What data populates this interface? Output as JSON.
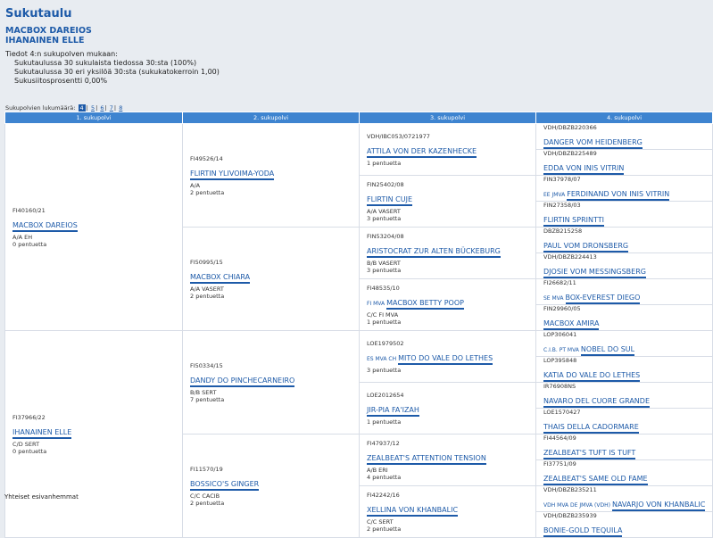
{
  "page": {
    "title": "Sukutaulu",
    "sire": "MACBOX DAREIOS",
    "dam": "IHANAINEN ELLE"
  },
  "stats": {
    "line1": "Tiedot 4:n sukupolven mukaan:",
    "line2": "Sukutaulussa 30 sukulaista tiedossa 30:sta (100%)",
    "line3": "Sukutaulussa 30 eri yksilöä 30:sta (sukukatokerroin 1,00)",
    "line4": "Sukusiitosprosentti 0,00%"
  },
  "generations": {
    "label": "Sukupolvien lukumäärä:",
    "options": [
      "4",
      "5",
      "6",
      "7",
      "8"
    ],
    "sep": "|"
  },
  "headers": [
    "1. sukupolvi",
    "2. sukupolvi",
    "3. sukupolvi",
    "4. sukupolvi"
  ],
  "g1": [
    {
      "reg": "FI40160/21",
      "name": "MACBOX DAREIOS",
      "info1": "A/A  EH",
      "info2": "0 pentuetta"
    },
    {
      "reg": "FI37966/22",
      "name": "IHANAINEN ELLE",
      "info1": "C/D  SERT",
      "info2": "0 pentuetta"
    }
  ],
  "g2": [
    {
      "reg": "FI49526/14",
      "name": "FLIRTIN YLIVOIMA-YODA",
      "info1": "A/A",
      "info2": "2 pentuetta"
    },
    {
      "reg": "FI50995/15",
      "name": "MACBOX CHIARA",
      "info1": "A/A  VASERT",
      "info2": "2 pentuetta"
    },
    {
      "reg": "FI50334/15",
      "name": "DANDY DO PINCHECARNEIRO",
      "info1": "B/B  SERT",
      "info2": "7 pentuetta"
    },
    {
      "reg": "FI11570/19",
      "name": "BOSSICO'S GINGER",
      "info1": "C/C  CACIB",
      "info2": "2 pentuetta"
    }
  ],
  "g3": [
    {
      "reg": "VDH/IBC053/0721977",
      "name": "ATTILA VON DER KAZENHECKE",
      "info1": "",
      "info2": "1 pentuetta"
    },
    {
      "reg": "FIN25402/08",
      "name": "FLIRTIN CUJE",
      "info1": "A/A  VASERT",
      "info2": "3 pentuetta"
    },
    {
      "reg": "FIN53204/08",
      "name": "ARISTOCRAT ZUR ALTEN BÜCKEBURG",
      "info1": "B/B  VASERT",
      "info2": "3 pentuetta"
    },
    {
      "reg": "FI48535/10",
      "title": "FI MVA",
      "name": "MACBOX BETTY POOP",
      "info1": "C/C  FI MVA",
      "info2": "1 pentuetta"
    },
    {
      "reg": "LOE1979502",
      "title": "ES MVA CH",
      "name": "MITO DO VALE DO LETHES",
      "info1": "",
      "info2": "3 pentuetta"
    },
    {
      "reg": "LOE2012654",
      "name": "JIR-PIA FA'IZAH",
      "info1": "",
      "info2": "1 pentuetta"
    },
    {
      "reg": "FI47937/12",
      "name": "ZEALBEAT'S ATTENTION TENSION",
      "info1": "A/B  ERI",
      "info2": "4 pentuetta"
    },
    {
      "reg": "FI42242/16",
      "name": "XELLINA VON KHANBALIC",
      "info1": "C/C  SERT",
      "info2": "2 pentuetta"
    }
  ],
  "g4": [
    {
      "reg": "VDH/DBZB220366",
      "name": "DANGER VOM HEIDENBERG"
    },
    {
      "reg": "VDH/DBZB225489",
      "name": "EDDA VON INIS VITRIN"
    },
    {
      "reg": "FIN37978/07",
      "title": "EE JMVA",
      "name": "FERDINAND VON INIS VITRIN"
    },
    {
      "reg": "FIN27358/03",
      "name": "FLIRTIN SPRINTTI"
    },
    {
      "reg": "DBZB215258",
      "name": "PAUL VOM DRONSBERG"
    },
    {
      "reg": "VDH/DBZB224413",
      "name": "DJOSIE VOM MESSINGSBERG"
    },
    {
      "reg": "FI26682/11",
      "title": "SE MVA",
      "name": "BOX-EVEREST DIEGO"
    },
    {
      "reg": "FIN29960/05",
      "name": "MACBOX AMIRA"
    },
    {
      "reg": "LOP306041",
      "title": "C.I.B. PT MVA",
      "name": "NOBEL DO SUL"
    },
    {
      "reg": "LOP395848",
      "name": "KATIA DO VALE DO LETHES"
    },
    {
      "reg": "IR76908NS",
      "name": "NAVARO DEL CUORE GRANDE"
    },
    {
      "reg": "LOE1570427",
      "name": "THAIS DELLA CADORMARE"
    },
    {
      "reg": "FI44564/09",
      "name": "ZEALBEAT'S TUFT IS TUFT"
    },
    {
      "reg": "FI37751/09",
      "name": "ZEALBEAT'S SAME OLD FAME"
    },
    {
      "reg": "VDH/DBZB235211",
      "title": "VDH MVA DE JMVA (VDH)",
      "name": "NAVARJO VON KHANBALIC"
    },
    {
      "reg": "VDH/DBZB235939",
      "name": "BONIE-GOLD TEQUILA"
    }
  ],
  "footer": "Yhteiset esivanhemmat"
}
